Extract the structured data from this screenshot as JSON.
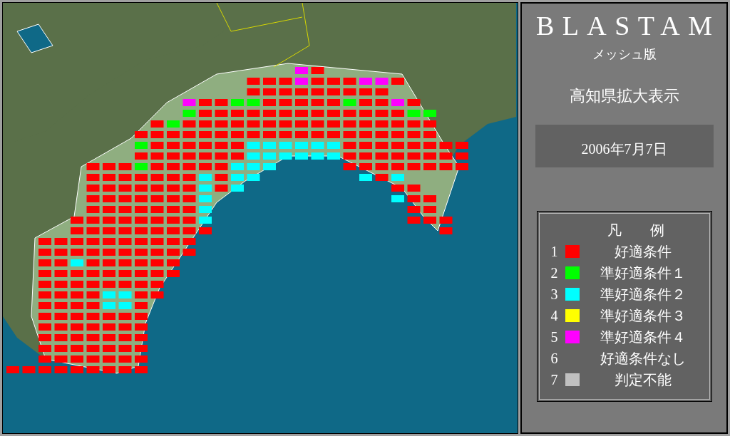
{
  "panel": {
    "title": "BLASTAM",
    "subtitle": "メッシュ版",
    "view": "高知県拡大表示",
    "date": "2006年7月7日"
  },
  "legend": {
    "title": "凡　　例",
    "items": [
      {
        "number": "1",
        "label": "好適条件",
        "color": "#ff0000"
      },
      {
        "number": "2",
        "label": "準好適条件１",
        "color": "#00ff00"
      },
      {
        "number": "3",
        "label": "準好適条件２",
        "color": "#00ffff"
      },
      {
        "number": "4",
        "label": "準好適条件３",
        "color": "#ffff00"
      },
      {
        "number": "5",
        "label": "準好適条件４",
        "color": "#ff00ff"
      },
      {
        "number": "6",
        "label": "好適条件なし"
      },
      {
        "number": "7",
        "label": "判定不能",
        "color": "#c0c0c0"
      }
    ]
  }
}
